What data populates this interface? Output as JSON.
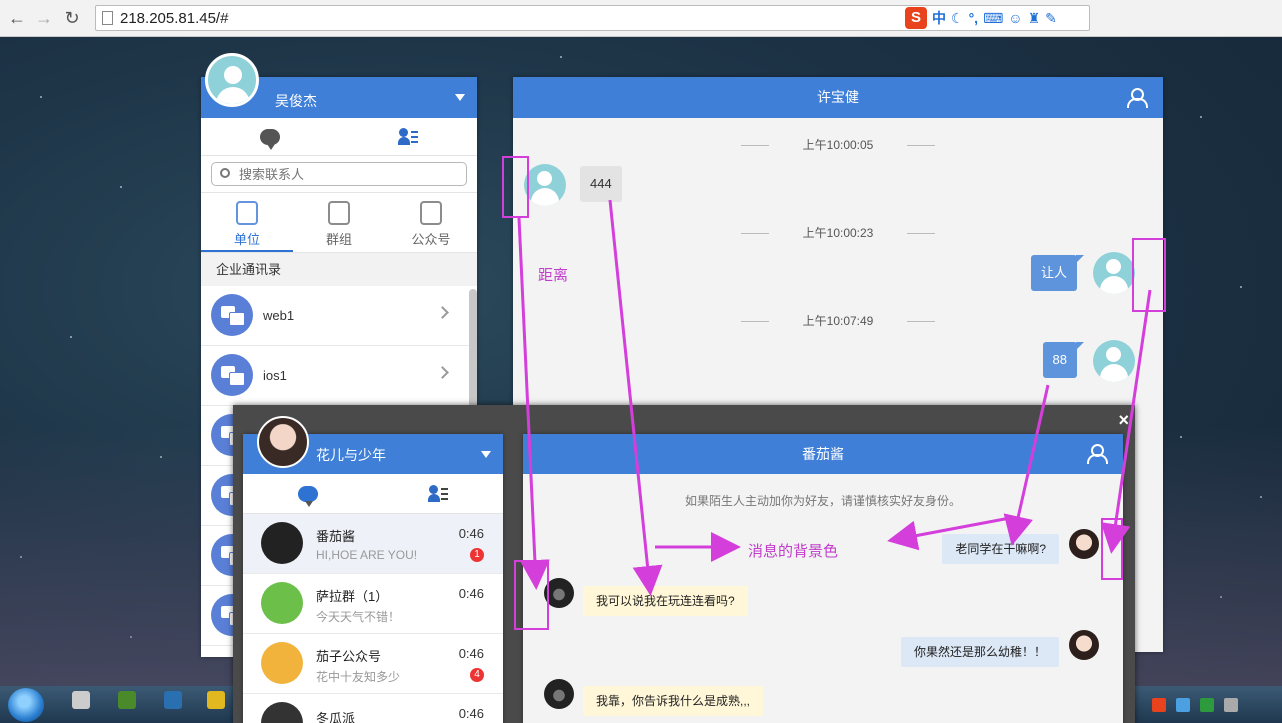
{
  "browser": {
    "url": "218.205.81.45/#",
    "ime": {
      "logo": "S",
      "mode": "中"
    }
  },
  "panel1": {
    "username": "吴俊杰",
    "search_placeholder": "搜索联系人",
    "tabs": [
      "单位",
      "群组",
      "公众号"
    ],
    "section_title": "企业通讯录",
    "units": [
      "web1",
      "ios1"
    ]
  },
  "chat1": {
    "title": "许宝健",
    "messages": [
      {
        "time": "上午10:00:05",
        "text": "444",
        "dir": "in"
      },
      {
        "time": "上午10:00:23",
        "text": "让人",
        "dir": "out"
      },
      {
        "time": "上午10:07:49",
        "text": "88",
        "dir": "out"
      }
    ]
  },
  "panel2": {
    "username": "花儿与少年",
    "conversations": [
      {
        "title": "番茄酱",
        "subtitle": "HI,HOE ARE YOU!",
        "time": "0:46",
        "badge": "1",
        "avatar_color": "#222222"
      },
      {
        "title": "萨拉群（1）",
        "subtitle": "今天天气不错！",
        "time": "0:46",
        "badge": "",
        "avatar_color": "#6cc04a"
      },
      {
        "title": "茄子公众号",
        "subtitle": "花中十友知多少",
        "time": "0:46",
        "badge": "4",
        "avatar_color": "#f2b33d"
      },
      {
        "title": "冬瓜派",
        "subtitle": "",
        "time": "0:46",
        "badge": "",
        "avatar_color": "#333333"
      }
    ]
  },
  "chat2": {
    "title": "番茄酱",
    "close": "×",
    "notice": "如果陌生人主动加你为好友，请谨慎核实好友身份。",
    "messages": [
      {
        "text": "老同学在干嘛啊?",
        "dir": "out"
      },
      {
        "text": "我可以说我在玩连连看吗?",
        "dir": "in"
      },
      {
        "text": "你果然还是那么幼稚！！",
        "dir": "out"
      },
      {
        "text": "我靠，你告诉我什么是成熟,,,",
        "dir": "in"
      }
    ]
  },
  "annotations": {
    "distance": "距离",
    "message_bg": "消息的背景色"
  },
  "colors": {
    "accent": "#3f7fd8",
    "annotation": "#d43fdc",
    "incoming_bubble": "#fff7d8",
    "outgoing_bubble": "#dde8f7"
  }
}
